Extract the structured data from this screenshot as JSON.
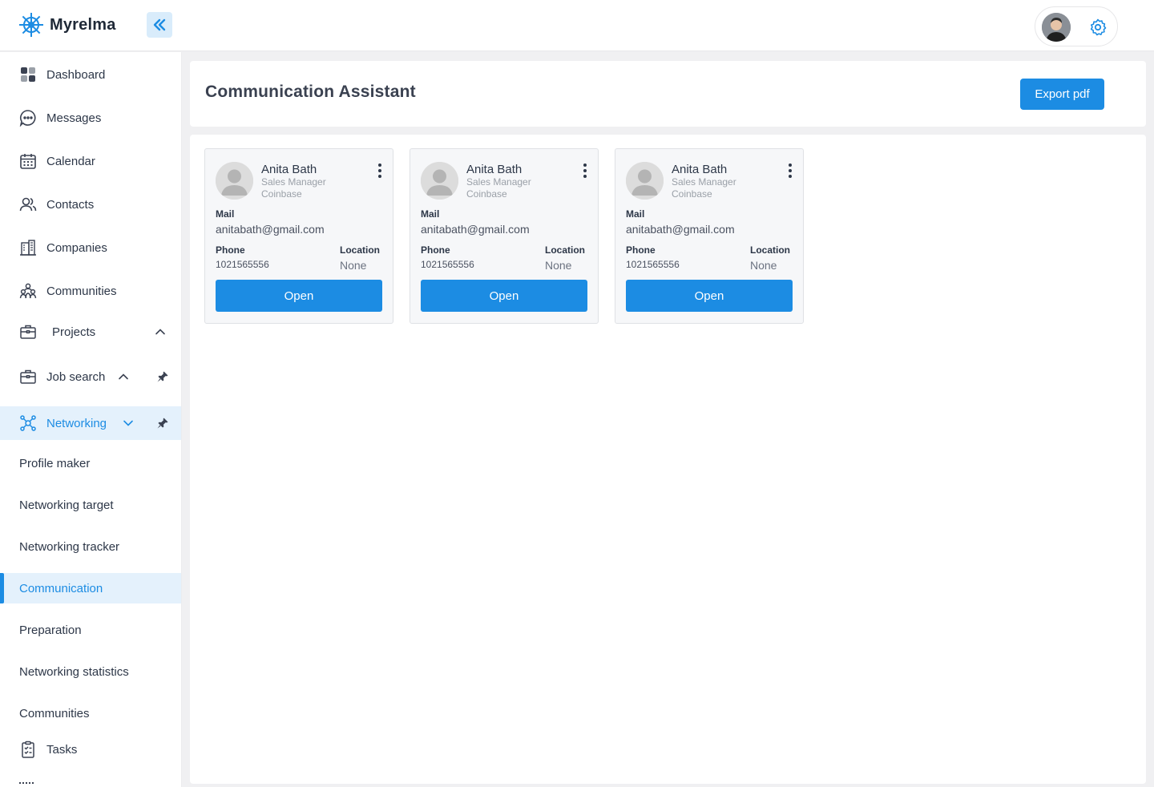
{
  "app": {
    "name": "Myrelma"
  },
  "sidebar": {
    "items": [
      {
        "label": "Dashboard",
        "icon": "grid-icon"
      },
      {
        "label": "Messages",
        "icon": "chat-icon"
      },
      {
        "label": "Calendar",
        "icon": "calendar-icon"
      },
      {
        "label": "Contacts",
        "icon": "users-icon"
      },
      {
        "label": "Companies",
        "icon": "building-icon"
      },
      {
        "label": "Communities",
        "icon": "community-icon"
      },
      {
        "label": "Projects",
        "icon": "briefcase-icon"
      },
      {
        "label": "Job search",
        "icon": "briefcase-icon"
      },
      {
        "label": "Networking",
        "icon": "network-icon"
      }
    ],
    "networking_sub": [
      {
        "label": "Profile maker"
      },
      {
        "label": "Networking target"
      },
      {
        "label": "Networking tracker"
      },
      {
        "label": "Communication",
        "active": true
      },
      {
        "label": "Preparation"
      },
      {
        "label": "Networking statistics"
      },
      {
        "label": "Communities"
      }
    ],
    "tasks": {
      "label": "Tasks",
      "icon": "clipboard-icon"
    }
  },
  "main": {
    "title": "Communication Assistant",
    "export_label": "Export pdf",
    "contacts": [
      {
        "name": "Anita Bath",
        "role": "Sales Manager",
        "company": "Coinbase",
        "mail_label": "Mail",
        "mail": "anitabath@gmail.com",
        "phone_label": "Phone",
        "phone": "1021565556",
        "location_label": "Location",
        "location": "None",
        "open_label": "Open"
      },
      {
        "name": "Anita Bath",
        "role": "Sales Manager",
        "company": "Coinbase",
        "mail_label": "Mail",
        "mail": "anitabath@gmail.com",
        "phone_label": "Phone",
        "phone": "1021565556",
        "location_label": "Location",
        "location": "None",
        "open_label": "Open"
      },
      {
        "name": "Anita Bath",
        "role": "Sales Manager",
        "company": "Coinbase",
        "mail_label": "Mail",
        "mail": "anitabath@gmail.com",
        "phone_label": "Phone",
        "phone": "1021565556",
        "location_label": "Location",
        "location": "None",
        "open_label": "Open"
      }
    ]
  },
  "colors": {
    "accent": "#1c8ce3",
    "accent_light": "#e4f1fc",
    "card_bg": "#f6f7f9"
  }
}
